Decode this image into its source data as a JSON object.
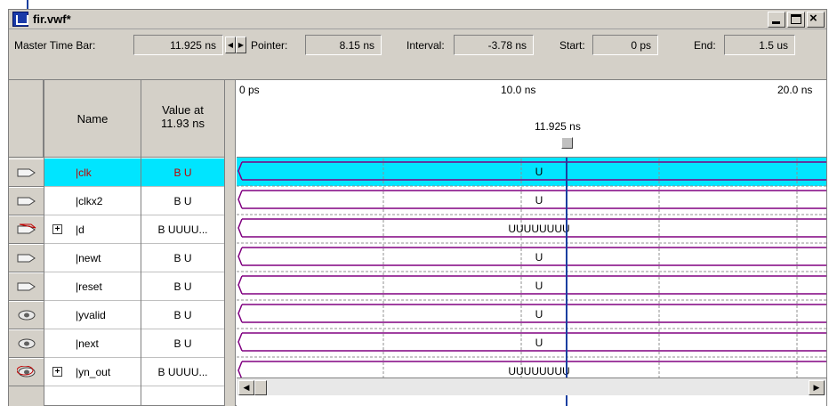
{
  "window": {
    "title": "fir.vwf*"
  },
  "toolbar": {
    "master_label": "Master Time Bar:",
    "master_value": "11.925 ns",
    "pointer_label": "Pointer:",
    "pointer_value": "8.15 ns",
    "interval_label": "Interval:",
    "interval_value": "-3.78 ns",
    "start_label": "Start:",
    "start_value": "0 ps",
    "end_label": "End:",
    "end_value": "1.5 us"
  },
  "table": {
    "name_header": "Name",
    "value_header_1": "Value at",
    "value_header_2": "11.93 ns",
    "rows": [
      {
        "name": "|clk",
        "value": "B U",
        "wave": "U",
        "icon": "input-pin-icon",
        "expandable": false,
        "selected": true
      },
      {
        "name": "|clkx2",
        "value": "B U",
        "wave": "U",
        "icon": "input-pin-icon",
        "expandable": false,
        "selected": false
      },
      {
        "name": "|d",
        "value": "B UUUU...",
        "wave": "UUUUUUUU",
        "icon": "input-bus-icon",
        "expandable": true,
        "selected": false
      },
      {
        "name": "|newt",
        "value": "B U",
        "wave": "U",
        "icon": "input-pin-icon",
        "expandable": false,
        "selected": false
      },
      {
        "name": "|reset",
        "value": "B U",
        "wave": "U",
        "icon": "input-pin-icon",
        "expandable": false,
        "selected": false
      },
      {
        "name": "|yvalid",
        "value": "B U",
        "wave": "U",
        "icon": "output-pin-icon",
        "expandable": false,
        "selected": false
      },
      {
        "name": "|next",
        "value": "B U",
        "wave": "U",
        "icon": "output-pin-icon",
        "expandable": false,
        "selected": false
      },
      {
        "name": "|yn_out",
        "value": "B UUUU...",
        "wave": "UUUUUUUU",
        "icon": "output-bus-icon",
        "expandable": true,
        "selected": false
      }
    ]
  },
  "timeline": {
    "ticks": [
      "0 ps",
      "10.0 ns",
      "20.0 ns"
    ],
    "cursor_label": "11.925 ns"
  },
  "colors": {
    "selection": "#00e5ff",
    "waveform": "#800080",
    "cursor": "#1a3fa0"
  }
}
